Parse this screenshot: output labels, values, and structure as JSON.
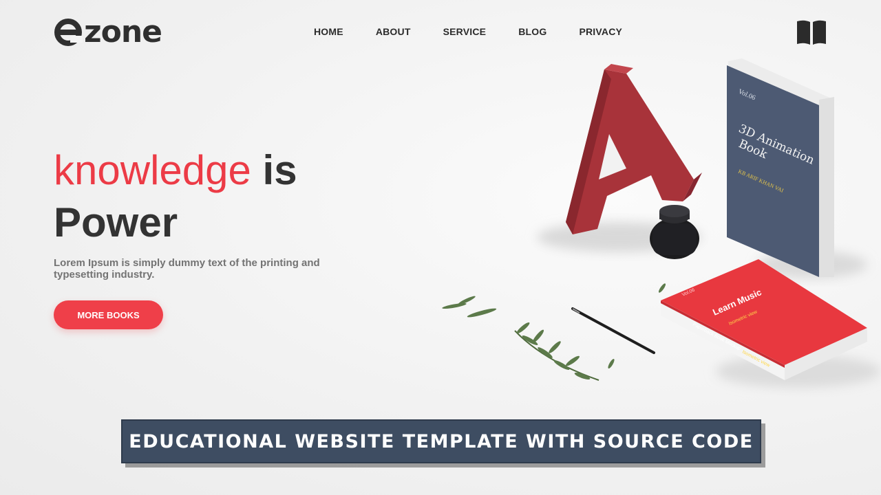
{
  "brand": {
    "logo_text": "zone"
  },
  "nav": {
    "items": [
      "HOME",
      "ABOUT",
      "SERVICE",
      "BLOG",
      "PRIVACY"
    ]
  },
  "hero": {
    "title_red": "knowledge",
    "title_rest_1": "is",
    "title_rest_2": "Power",
    "description": "Lorem Ipsum is simply dummy text of the printing and typesetting industry.",
    "cta_label": "MORE BOOKS"
  },
  "illustration": {
    "blue_book": {
      "vol": "Vol.06",
      "title_1": "3D Animation",
      "title_2": "Book",
      "author": "KB ARIF KHAN VAI"
    },
    "red_book": {
      "vol": "Vol.06",
      "title": "Learn Music",
      "subtitle": "Isometric view",
      "spine_note": "Paperback Book Mockup",
      "corner_note": "Isometric view"
    }
  },
  "banner": {
    "text": "EDUCATIONAL WEBSITE TEMPLATE WITH SOURCE CODE"
  },
  "colors": {
    "accent": "#ef3f49",
    "dark": "#333333",
    "banner": "#3e4d62",
    "book_blue": "#4d5a73",
    "letter_red": "#a8333a"
  }
}
